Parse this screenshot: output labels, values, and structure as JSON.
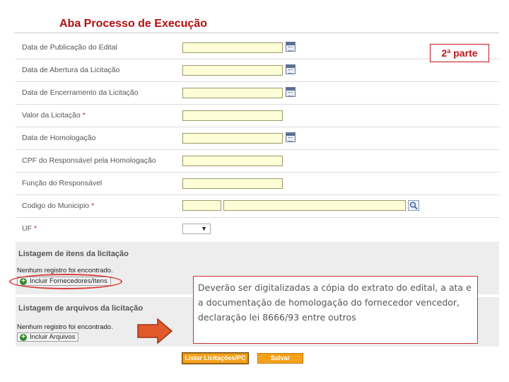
{
  "page": {
    "title": "Aba Processo de Execução",
    "part_label": "2ª parte"
  },
  "form": {
    "fields": [
      {
        "label": "Data de Publicação do Edital",
        "required": false
      },
      {
        "label": "Data de Abertura da Licitação",
        "required": false
      },
      {
        "label": "Data de Encerramento da Licitação",
        "required": false
      },
      {
        "label": "Valor da Licitação",
        "required": true
      },
      {
        "label": "Data de Homologação",
        "required": false
      },
      {
        "label": "CPF do Responsável pela Homologação",
        "required": false
      },
      {
        "label": "Função do Responsável",
        "required": false
      },
      {
        "label": "Codigo do Municipio",
        "required": true
      },
      {
        "label": "UF",
        "required": true
      }
    ],
    "uf_select_value": "",
    "required_mark": "*"
  },
  "items_section": {
    "title": "Listagem de itens da licitação",
    "empty_text": "Nenhum registro foi encontrado.",
    "button_label": "Incluir Fornecedores/Itens"
  },
  "files_section": {
    "title": "Listagem de arquivos da licitação",
    "empty_text": "Nenhum registro foi encontrado.",
    "button_label": "Incluir Arquivos"
  },
  "note": {
    "text": "Deverão ser digitalizadas a cópia do extrato do edital, a ata e a documentação de homologação do fornecedor vencedor, declaração lei 8666/93 entre outros"
  },
  "buttons": {
    "list_label": "Listar Licitações/PC",
    "save_label": "Salvar"
  },
  "colors": {
    "title": "#b01010",
    "annotation": "#c0161b",
    "field_yellow": "#fdfdd8",
    "button_orange": "#f4a21c",
    "arrow": "#e05a2a",
    "section_bg": "#ededed"
  },
  "icons": {
    "calendar": "calendar-icon",
    "search": "search-icon",
    "add": "plus-circle-icon",
    "arrow": "arrow-right-icon",
    "dropdown": "dropdown-arrow-icon"
  }
}
